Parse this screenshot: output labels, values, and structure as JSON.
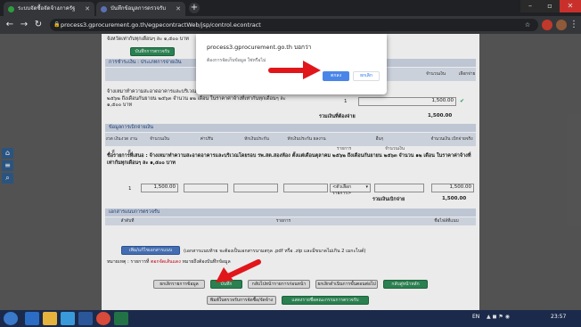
{
  "browser": {
    "tabs": [
      {
        "title": "ระบบจัดซื้อจัดจ้างภาครัฐ",
        "favicon_color": "#2e9c3f"
      },
      {
        "title": "บันทึกข้อมูลการตรวจรับ",
        "favicon_color": "#5b6fb5"
      }
    ],
    "new_tab_glyph": "+",
    "url": "process3.gprocurement.go.th/egpecontractWeb/jsp/control.econtract"
  },
  "dialog": {
    "origin": "process3.gprocurement.go.th บอกว่า",
    "message": "ต้องการจัดเก็บข้อมูล ใช่หรือไม่",
    "ok_label": "ตกลง",
    "cancel_label": "ยกเลิก"
  },
  "page": {
    "top_text": "จังหวัดเท่ากับทุกเดือนๆ ละ ๑,๕๐๐ บาท",
    "top_button": "บันทึกการตรวจรับ",
    "payment_section": {
      "title": "การชำระเงิน : ประเภทการจ่ายเงิน",
      "col_amount": "จำนวนเงิน",
      "col_select": "เลือกจ่าย",
      "item_text": "จ้างเหมาทำความสะอาดอาคารและบริเวณโดยรอบ รพ.สต.สองห้อง ตั้งแต่เดือนตุลาคม ๒๕๖๒ ถึงเดือนกันยายน ๒๕๖๓ จำนวน ๑๒ เดือน ในราคาค่าจ้างที่เท่ากันทุกเดือนๆ ละ ๑,๕๐๐ บาท",
      "item_number": "1",
      "amount_value": "1,500.00",
      "checkbox": "✔",
      "total_label": "รวมเงินที่ต้องจ่าย",
      "total_value": "1,500.00"
    },
    "disbursement_section": {
      "title": "ข้อมูลการเบิกจ่ายเงิน",
      "headers": [
        "งวด เงินที่",
        "งวด งานที่",
        "จำนวนเงิน",
        "ค่าปรับ",
        "หักเงินประกัน",
        "หักเงินประกัน ผลงาน",
        "อื่นๆ",
        "จำนวนเงิน เบิกจ่ายจริง"
      ],
      "sub_headers": [
        "รายการ",
        "จำนวนเงิน"
      ],
      "item_text": "ชื่อรายการที่เสนอ : จ้างเหมาทำความสะอาดอาคารและบริเวณโดยรอบ รพ.สต.สองห้อง ตั้งแต่เดือนตุลาคม ๒๕๖๒ ถึงเดือนกันยายน ๒๕๖๓ จำนวน ๑๒ เดือน ในราคาค่าจ้างที่เท่ากันทุกเดือนๆ ละ ๑,๕๐๐ บาท",
      "row_number": "1",
      "row_amount": "1,500.00",
      "select_placeholder": "<ตัวเลือกรายการ>",
      "row_result": "1,500.00",
      "total_label": "รวมเงินเบิกจ่าย",
      "total_value": "1,500.00"
    },
    "documents_section": {
      "title": "เอกสารแนบการตรวจรับ",
      "col_order": "ลำดับที่",
      "col_item": "รายการ",
      "col_file": "ชื่อไฟล์ที่แนบ",
      "add_button": "เพิ่ม/แก้ไขเอกสารแนบ",
      "hint": "(เอกสารแนบท้าย จะต้องเป็นเอกสารนามสกุล .pdf หรือ .zip และมีขนาดไม่เกิน 2 เมกะไบต์)",
      "note_prefix": "หมายเหตุ : รายการที่",
      "note_highlight": "ตอกจัดเส้นแดง",
      "note_suffix": "หมายถึงต้องบันทึกข้อมูล"
    },
    "buttons": {
      "cancel_all": "ยกเลิกรายการข้อมูล",
      "save": "บันทึก",
      "back": "กลับไปหน้ารายการก่อนหน้า",
      "delete_step": "ยกเลิกดำเนินการขั้นตอนต่อไป",
      "next_page": "กลับสู่หน้าหลัก",
      "print_form": "พิมพ์ใบตรวจรับการจัดซื้อ/จัดจ้าง",
      "print_other": "แสดงรายชื่อคณะกรรมการตรวจรับ"
    }
  },
  "sidebar": {
    "icons": [
      "home-icon",
      "menu-icon",
      "search-icon"
    ]
  },
  "taskbar": {
    "lang": "EN",
    "time": "23:57",
    "icons": [
      "start-icon",
      "ie-icon",
      "explorer-icon",
      "media-icon",
      "word-icon",
      "chrome-icon",
      "excel-icon"
    ]
  },
  "colors": {
    "arrow": "#e0161b",
    "ok_button": "#4a86e8",
    "section_header": "#cfd7e6"
  }
}
